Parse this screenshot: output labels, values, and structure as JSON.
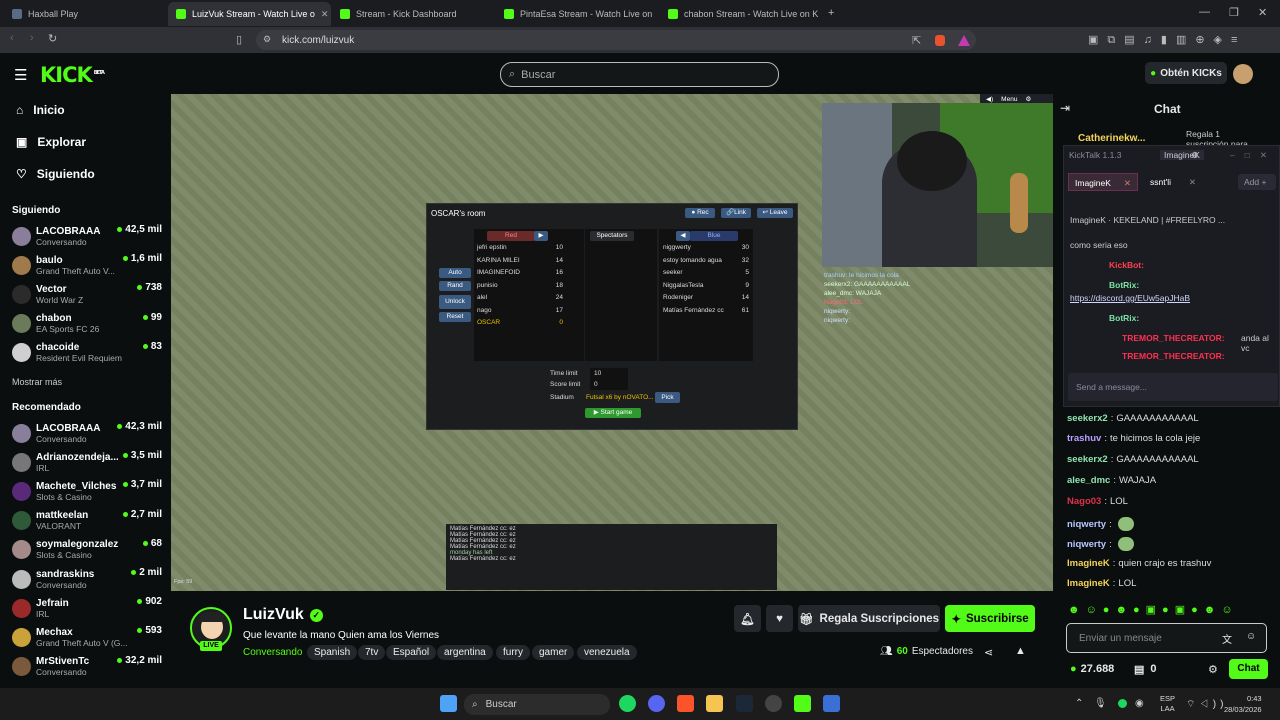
{
  "browser": {
    "tabs": [
      {
        "title": "Haxball Play",
        "color": "#5a6b85"
      },
      {
        "title": "LuizVuk Stream - Watch Live o",
        "color": "#53fc18"
      },
      {
        "title": "Stream - Kick Dashboard",
        "color": "#53fc18"
      },
      {
        "title": "PintaEsa Stream - Watch Live on",
        "color": "#53fc18"
      },
      {
        "title": "chabon Stream - Watch Live on K",
        "color": "#53fc18"
      }
    ],
    "url": "kick.com/luizvuk"
  },
  "header": {
    "logo": "KICK",
    "beta": "BETA",
    "search_placeholder": "Buscar",
    "get_kicks": "Obtén KICKs"
  },
  "nav": {
    "home": "Inicio",
    "explore": "Explorar",
    "following": "Siguiendo"
  },
  "sidebar": {
    "following_title": "Siguiendo",
    "following": [
      {
        "name": "LACOBRAAA",
        "game": "Conversando",
        "viewers": "42,5 mil",
        "color": "#8a7f9a"
      },
      {
        "name": "baulo",
        "game": "Grand Theft Auto V...",
        "viewers": "1,6 mil",
        "color": "#a07a4a"
      },
      {
        "name": "Vector",
        "game": "World War Z",
        "viewers": "738",
        "color": "#2b2b2b"
      },
      {
        "name": "chabon",
        "game": "EA Sports FC 26",
        "viewers": "99",
        "color": "#6a7a5a"
      },
      {
        "name": "chacoide",
        "game": "Resident Evil Requiem",
        "viewers": "83",
        "color": "#cfcfcf"
      }
    ],
    "show_more": "Mostrar más",
    "recommended_title": "Recomendado",
    "recommended": [
      {
        "name": "LACOBRAAA",
        "game": "Conversando",
        "viewers": "42,3 mil",
        "color": "#8a7f9a"
      },
      {
        "name": "Adrianozendeja...",
        "game": "IRL",
        "viewers": "3,5 mil",
        "color": "#777"
      },
      {
        "name": "Machete_Vilches",
        "game": "Slots & Casino",
        "viewers": "3,7 mil",
        "color": "#5a2a7a"
      },
      {
        "name": "mattkeelan",
        "game": "VALORANT",
        "viewers": "2,7 mil",
        "color": "#2e5a3a"
      },
      {
        "name": "soymalegonzalez",
        "game": "Slots & Casino",
        "viewers": "68",
        "color": "#a58a8a"
      },
      {
        "name": "sandraskins",
        "game": "Conversando",
        "viewers": "2 mil",
        "color": "#bbb"
      },
      {
        "name": "Jefrain",
        "game": "IRL",
        "viewers": "902",
        "color": "#9a2a2a"
      },
      {
        "name": "Mechax",
        "game": "Grand Theft Auto V (G...",
        "viewers": "593",
        "color": "#c9a23a"
      },
      {
        "name": "MrStivenTc",
        "game": "Conversando",
        "viewers": "32,2 mil",
        "color": "#7a5a3a"
      }
    ]
  },
  "game": {
    "room_title": "OSCAR's room",
    "rec": "Rec",
    "link": "Link",
    "leave": "Leave",
    "red": "Red",
    "blue": "Blue",
    "spectators": "Spectators",
    "auto": "Auto",
    "rand": "Rand",
    "unlock": "Unlock",
    "reset": "Reset",
    "red_players": [
      {
        "n": "jefri epstin",
        "s": "10"
      },
      {
        "n": "KARINA MILEI",
        "s": "14"
      },
      {
        "n": "IMAGINEFOID",
        "s": "16"
      },
      {
        "n": "punisio",
        "s": "18"
      },
      {
        "n": "alel",
        "s": "24"
      },
      {
        "n": "nago",
        "s": "17"
      },
      {
        "n": "OSCAR",
        "s": "0"
      }
    ],
    "blue_players": [
      {
        "n": "niggwerty",
        "s": "30"
      },
      {
        "n": "estoy tomando agua",
        "s": "32"
      },
      {
        "n": "seeker",
        "s": "5"
      },
      {
        "n": "NiggalasTesla",
        "s": "9"
      },
      {
        "n": "Rodeniger",
        "s": "14"
      },
      {
        "n": "Matías Fernández cc",
        "s": "61"
      }
    ],
    "time_limit_label": "Time limit",
    "time_limit": "10",
    "score_limit_label": "Score limit",
    "score_limit": "0",
    "stadium_label": "Stadium",
    "stadium": "Futsal x6 by nOVATO...",
    "pick": "Pick",
    "start": "Start game",
    "menu": "Menu",
    "fps": "Fps: 59",
    "chat_lines": [
      "Matías Fernández cc: ez",
      "Matías Fernández cc: ez",
      "Matías Fernández cc: ez",
      "Matías Fernández cc: ez",
      "monday has left",
      "Matías Fernández cc: ez"
    ]
  },
  "overlay_chat": [
    "trashuv: te hicimos la cola",
    "seekerx2: GAAAAAAAAAAAL",
    "alee_dmc: WAJAJA",
    "Nago03: LOL",
    "niqwerty:",
    "niqwerty:"
  ],
  "stream": {
    "name": "LuizVuk",
    "title": "Que levante la mano Quien ama los Viernes",
    "category": "Conversando",
    "tags": [
      "Spanish",
      "7tv",
      "Español",
      "argentina",
      "furry",
      "gamer",
      "venezuela"
    ],
    "live": "LIVE",
    "viewers": "60",
    "viewers_label": "Espectadores",
    "gift": "Regala Suscripciones",
    "subscribe": "Suscribirse"
  },
  "chat": {
    "title": "Chat",
    "pinned_user": "Catherinekw...",
    "pinned_text": "Regala 1 suscripción para",
    "messages": [
      {
        "user": "seekerx2",
        "text": "GAAAAAAAAAAAL",
        "color": "#8fe3b0"
      },
      {
        "user": "trashuv",
        "text": "te hicimos la cola jeje",
        "color": "#b6a0ff"
      },
      {
        "user": "seekerx2",
        "text": "GAAAAAAAAAAAL",
        "color": "#8fe3b0"
      },
      {
        "user": "alee_dmc",
        "text": "WAJAJA",
        "color": "#8fe3b0"
      },
      {
        "user": "Nago03",
        "text": "LOL",
        "color": "#e0304a"
      },
      {
        "user": "niqwerty",
        "text": "",
        "color": "#b6c7ff"
      },
      {
        "user": "niqwerty",
        "text": "",
        "color": "#b6c7ff"
      },
      {
        "user": "ImagineK",
        "text": "quien crajo es trashuv",
        "color": "#f5d35a"
      },
      {
        "user": "ImagineK",
        "text": "LOL",
        "color": "#f5d35a"
      }
    ],
    "input_placeholder": "Enviar un mensaje",
    "kicks": "27.688",
    "gifts": "0",
    "send": "Chat"
  },
  "kicktalk": {
    "title": "KickTalk 1.1.3",
    "user": "ImagineK",
    "tabs": [
      "ImagineK",
      "ssnt'li"
    ],
    "add": "Add",
    "header": "ImagineK  ·  KEKELAND | #FREELYRO ...",
    "first": "como seria eso",
    "bot1": "KickBot:",
    "bot2": "BotRix:",
    "link": "https://discord.gg/EUw5apJHaB",
    "bot3": "BotRix:",
    "t1": "TREMOR_THECREATOR:",
    "t1msg": "anda al vc",
    "t2": "TREMOR_THECREATOR:",
    "send": "Send a message..."
  },
  "taskbar": {
    "search": "Buscar",
    "lang1": "ESP",
    "lang2": "LAA",
    "time": "0:43",
    "date": "28/03/2026"
  }
}
